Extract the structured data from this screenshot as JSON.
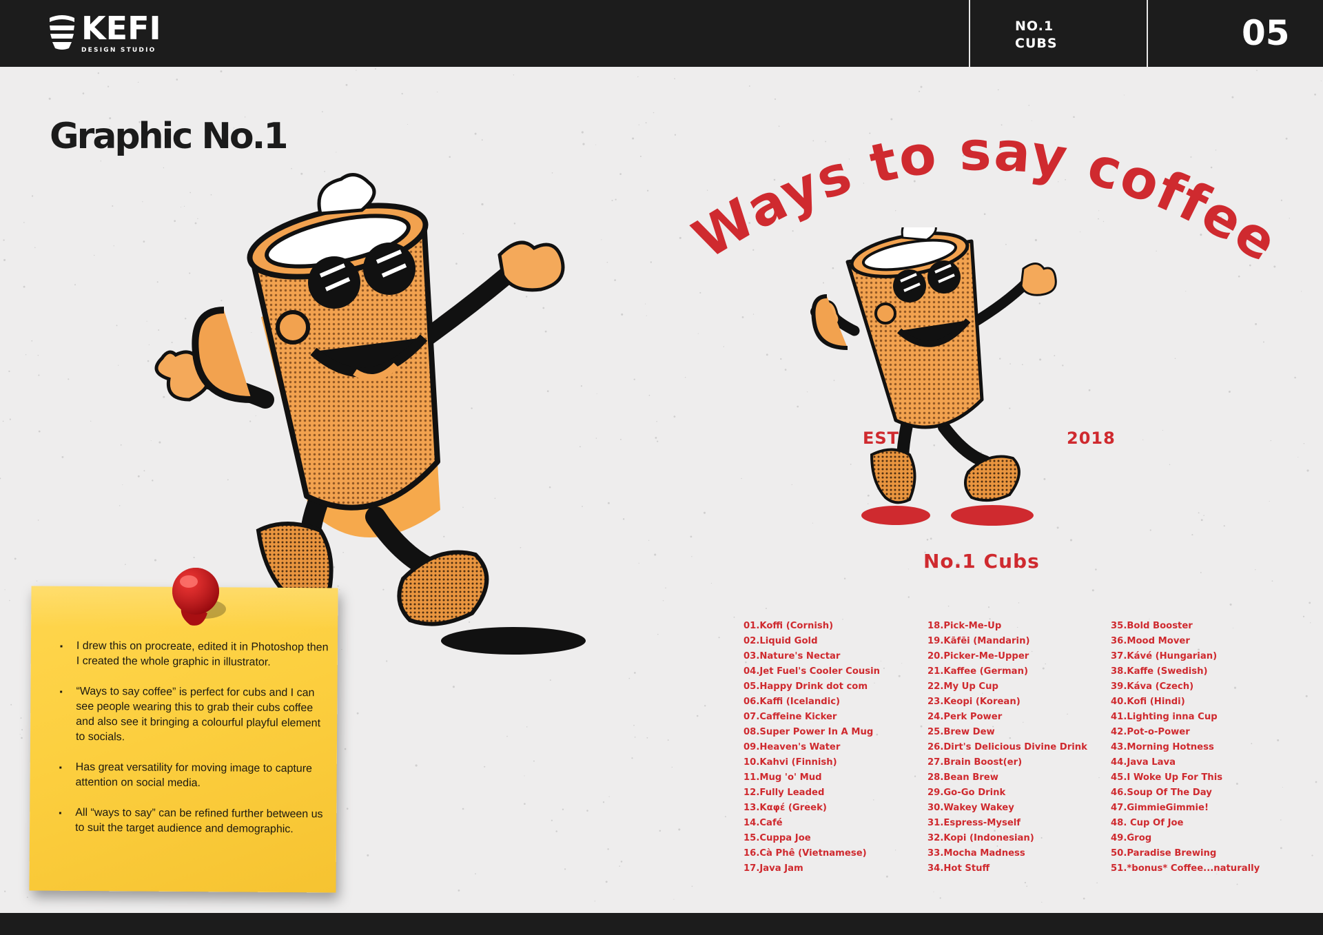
{
  "header": {
    "logo_word": "KEFI",
    "logo_sub": "DESIGN STUDIO",
    "section_line1": "NO.1",
    "section_line2": "CUBS",
    "page_number": "05"
  },
  "title": "Graphic No.1",
  "design": {
    "headline": "Ways to say coffee",
    "est": "EST",
    "year": "2018",
    "brand": "No.1 Cubs"
  },
  "names": {
    "col1": [
      "01.Koffi (Cornish)",
      "02.Liquid Gold",
      "03.Nature's Nectar",
      "04.Jet Fuel's Cooler Cousin",
      "05.Happy Drink dot com",
      "06.Kaffi (Icelandic)",
      "07.Caffeine Kicker",
      "08.Super Power In A Mug",
      "09.Heaven's Water",
      "10.Kahvi (Finnish)",
      "11.Mug 'o' Mud",
      "12.Fully Leaded",
      "13.Καφέ (Greek)",
      "14.Café",
      "15.Cuppa Joe",
      "16.Cà Phê (Vietnamese)",
      "17.Java Jam"
    ],
    "col2": [
      "18.Pick-Me-Up",
      "19.Kāfēi (Mandarin)",
      "20.Picker-Me-Upper",
      "21.Kaffee (German)",
      "22.My Up Cup",
      "23.Keopi (Korean)",
      "24.Perk Power",
      "25.Brew Dew",
      "26.Dirt's Delicious Divine Drink",
      "27.Brain Boost(er)",
      "28.Bean Brew",
      "29.Go-Go Drink",
      "30.Wakey Wakey",
      "31.Espress-Myself",
      "32.Kopi (Indonesian)",
      "33.Mocha Madness",
      "34.Hot Stuff"
    ],
    "col3": [
      "35.Bold Booster",
      "36.Mood Mover",
      "37.Kávé (Hungarian)",
      "38.Kaffe (Swedish)",
      "39.Káva (Czech)",
      "40.Kofi (Hindi)",
      "41.Lighting inna Cup",
      "42.Pot-o-Power",
      "43.Morning Hotness",
      "44.Java Lava",
      "45.I Woke Up For This",
      "46.Soup Of The Day",
      "47.GimmieGimmie!",
      "48. Cup Of Joe",
      "49.Grog",
      "50.Paradise Brewing",
      "51.*bonus* Coffee...naturally"
    ]
  },
  "note": {
    "bullet_symbol": "▪",
    "points": [
      "I drew this on procreate, edited it in Photoshop then I created the whole graphic in illustrator.",
      "“Ways to say coffee” is perfect for cubs and I can see people wearing this to grab their cubs coffee and also see it bringing a colourful playful element to socials.",
      "Has great versatility for moving image to capture attention on social media.",
      "All “ways to say” can be refined further between us to suit the target audience and demographic."
    ]
  },
  "colors": {
    "bar": "#1c1c1c",
    "background": "#eeeded",
    "accent_red": "#cf2a2f",
    "mascot_orange": "#f2a24f",
    "note_yellow": "#fcd03f"
  },
  "icons": {
    "logo": "striped-cup-logo-icon",
    "pin": "red-push-pin-icon",
    "mascot": "coffee-cup-mascot-illustration"
  }
}
